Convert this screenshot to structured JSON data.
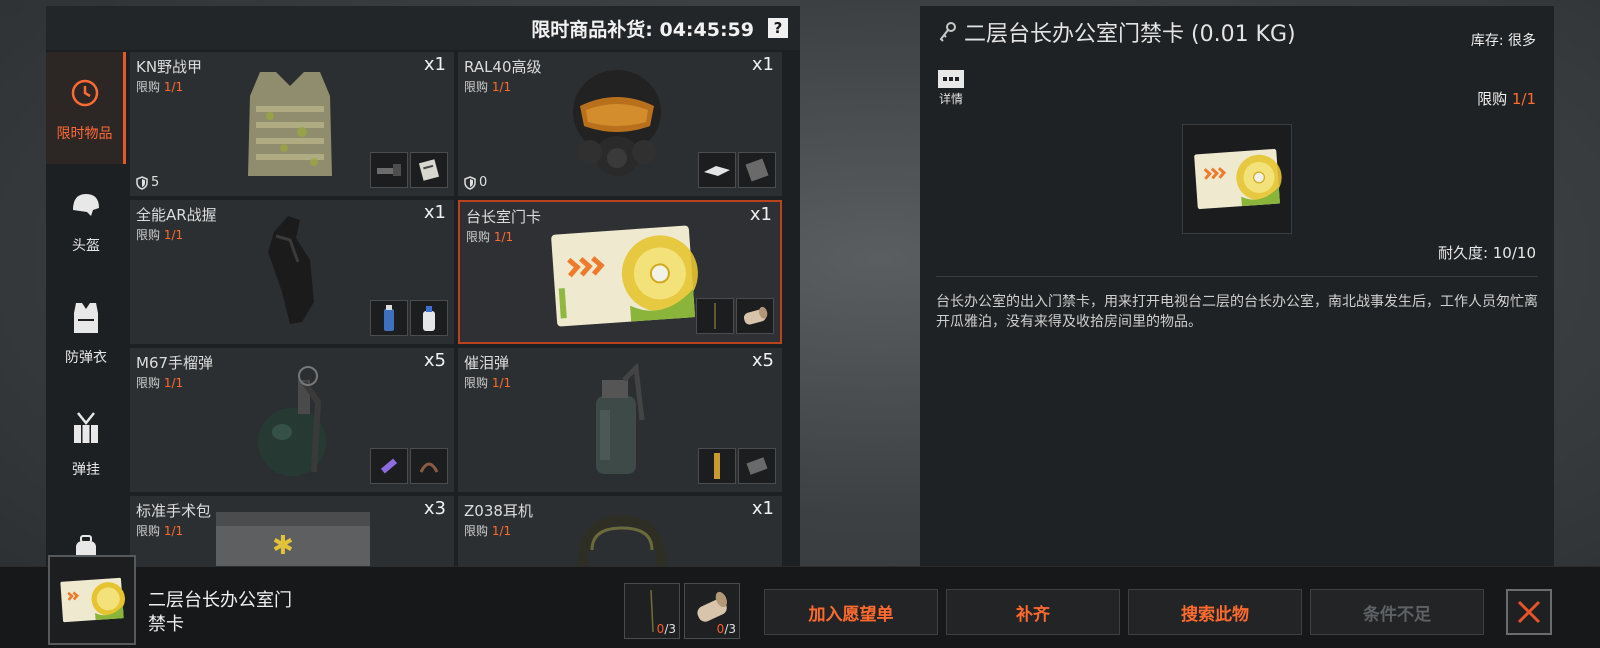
{
  "header": {
    "restock_label": "限时商品补货: 04:45:59",
    "help_label": "?"
  },
  "categories": [
    {
      "label": "限时物品",
      "icon": "clock-icon",
      "active": true
    },
    {
      "label": "头盔",
      "icon": "helmet-icon"
    },
    {
      "label": "防弹衣",
      "icon": "vest-icon"
    },
    {
      "label": "弹挂",
      "icon": "chest-rig-icon"
    },
    {
      "label": "",
      "icon": "backpack-icon"
    }
  ],
  "items": [
    {
      "name": "KN野战甲",
      "limit_prefix": "限购 ",
      "limit_num": "1/1",
      "qty": "x1",
      "armor": "5",
      "art": "plate-carrier",
      "mats": [
        "tool-icon",
        "document-icon"
      ]
    },
    {
      "name": "RAL40高级",
      "limit_prefix": "限购 ",
      "limit_num": "1/1",
      "qty": "x1",
      "armor": "0",
      "art": "gas-mask",
      "mats": [
        "plate-icon",
        "fabric-icon"
      ]
    },
    {
      "name": "全能AR战握",
      "limit_prefix": "限购 ",
      "limit_num": "1/1",
      "qty": "x1",
      "art": "grip",
      "mats": [
        "bottle-icon",
        "spray-icon"
      ]
    },
    {
      "name": "台长室门卡",
      "limit_prefix": "限购 ",
      "limit_num": "1/1",
      "qty": "x1",
      "art": "keycard",
      "selected": true,
      "mats": [
        "wire-icon",
        "roll-icon"
      ]
    },
    {
      "name": "M67手榴弹",
      "limit_prefix": "限购 ",
      "limit_num": "1/1",
      "qty": "x5",
      "art": "grenade",
      "mats": [
        "syringe-icon",
        "clamp-icon"
      ]
    },
    {
      "name": "催泪弹",
      "limit_prefix": "限购 ",
      "limit_num": "1/1",
      "qty": "x5",
      "art": "smoke-grenade",
      "mats": [
        "stick-icon",
        "plate-icon"
      ]
    },
    {
      "name": "标准手术包",
      "limit_prefix": "限购 ",
      "limit_num": "1/1",
      "qty": "x3",
      "art": "surgical-kit",
      "mats": []
    },
    {
      "name": "Z038耳机",
      "limit_prefix": "限购 ",
      "limit_num": "1/1",
      "qty": "x1",
      "art": "headset",
      "mats": []
    }
  ],
  "detail": {
    "title": "二层台长办公室门禁卡 (0.01 KG)",
    "stock": "库存: 很多",
    "details_label": "详情",
    "limit_prefix": "限购 ",
    "limit_num": "1/1",
    "durability": "耐久度: 10/10",
    "description": "台长办公室的出入门禁卡，用来打开电视台二层的台长办公室，南北战事发生后，工作人员匆忙离开瓜雅泊，没有来得及收拾房间里的物品。"
  },
  "bottom": {
    "selected_name_line1": "二层台长办公室门",
    "selected_name_line2": "禁卡",
    "requirements": [
      {
        "icon": "wire-icon",
        "have": "0",
        "total": "/3"
      },
      {
        "icon": "roll-icon",
        "have": "0",
        "total": "/3"
      }
    ],
    "buttons": [
      {
        "label": "加入愿望单",
        "enabled": true
      },
      {
        "label": "补齐",
        "enabled": true
      },
      {
        "label": "搜索此物",
        "enabled": true
      },
      {
        "label": "条件不足",
        "enabled": false
      }
    ]
  },
  "colors": {
    "accent": "#ff6b2e",
    "panel": "#1f2224",
    "card": "#2b2f32",
    "selected_border": "#b8431e"
  }
}
